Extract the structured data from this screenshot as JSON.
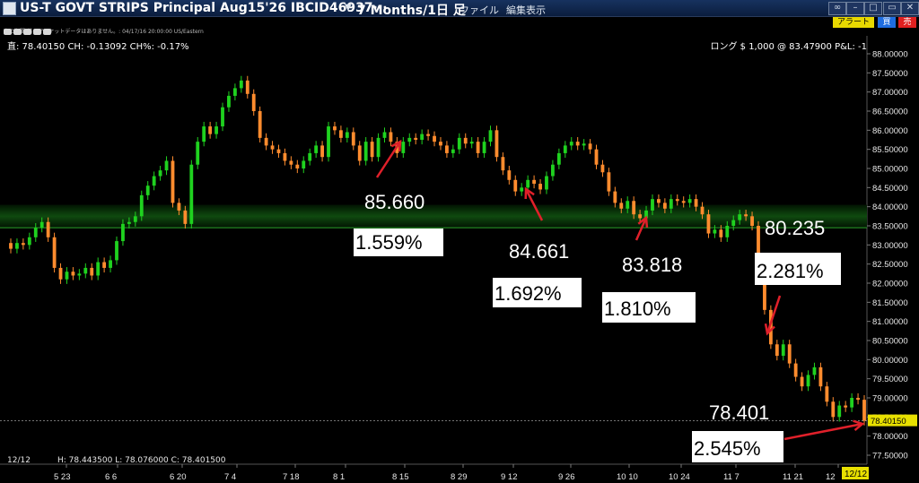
{
  "titlebar": {
    "title": "US-T GOVT STRIPS Principal Aug15'26 IBCID46937···",
    "period": "7 Months/1日 足",
    "menu": [
      "ファイル",
      "編集",
      "表示"
    ],
    "dropdown_arrow": "▼"
  },
  "toolbar": {
    "alert": "アラート",
    "buy": "買",
    "sell": "売",
    "subtitle": "次の期間(前のマーケットデータはありません。: 04/17/16 20:00:00 US/Eastern"
  },
  "info": {
    "price_line": "直: 78.40150 CH: -0.13092 CH%: -0.17%",
    "position_line": "ロング $ 1,000 @ 83.47900 P&L: -1",
    "ohlc_line": "H: 78.443500 L: 78.076000 C: 78.401500",
    "cursor_date": "12/12",
    "last_price_tag": "78.40150",
    "last_date_tag": "12/12"
  },
  "colors": {
    "up": "#1fd21f",
    "down": "#ff8c2e",
    "arrow": "#e0202a",
    "band": "#0f4a0f",
    "text": "#ffffff",
    "last_tag": "#e8e000"
  },
  "chart_data": {
    "type": "candlestick",
    "ylim": [
      77.3,
      88.3
    ],
    "yticks": [
      "88.00000",
      "87.50000",
      "87.00000",
      "86.50000",
      "86.00000",
      "85.50000",
      "85.00000",
      "84.50000",
      "84.00000",
      "83.50000",
      "83.00000",
      "82.50000",
      "82.00000",
      "81.50000",
      "81.00000",
      "80.50000",
      "80.00000",
      "79.50000",
      "79.00000",
      "78.50000",
      "78.00000",
      "77.50000"
    ],
    "ytick_values": [
      88.0,
      87.5,
      87.0,
      86.5,
      86.0,
      85.5,
      85.0,
      84.5,
      84.0,
      83.5,
      83.0,
      82.5,
      82.0,
      81.5,
      81.0,
      80.5,
      80.0,
      79.5,
      79.0,
      78.5,
      78.0,
      77.5
    ],
    "xticks": [
      "5 23",
      "6 6",
      "6 20",
      "7 4",
      "7 18",
      "8 1",
      "8 15",
      "8 29",
      "9 12",
      "9 26",
      "10 10",
      "10 24",
      "11 7",
      "11 21",
      "12"
    ],
    "closes": [
      82.9,
      83.05,
      83.0,
      83.2,
      83.45,
      83.6,
      83.2,
      82.4,
      82.1,
      82.3,
      82.2,
      82.25,
      82.4,
      82.2,
      82.55,
      82.4,
      82.6,
      83.1,
      83.55,
      83.6,
      83.75,
      84.3,
      84.55,
      84.8,
      84.95,
      85.2,
      84.1,
      83.9,
      83.55,
      85.1,
      85.7,
      86.1,
      85.9,
      86.1,
      86.6,
      86.9,
      87.1,
      87.3,
      86.95,
      86.5,
      85.8,
      85.6,
      85.5,
      85.4,
      85.2,
      85.1,
      85.0,
      85.2,
      85.4,
      85.6,
      85.3,
      86.1,
      86.0,
      85.8,
      85.95,
      85.6,
      85.2,
      85.7,
      85.3,
      85.8,
      85.95,
      85.7,
      85.4,
      85.7,
      85.8,
      85.75,
      85.9,
      85.85,
      85.7,
      85.6,
      85.4,
      85.5,
      85.8,
      85.65,
      85.7,
      85.4,
      85.7,
      86.0,
      85.3,
      84.95,
      84.7,
      84.4,
      84.5,
      84.7,
      84.6,
      84.45,
      84.8,
      85.1,
      85.4,
      85.6,
      85.7,
      85.6,
      85.65,
      85.5,
      85.1,
      84.9,
      84.4,
      84.1,
      83.95,
      84.15,
      83.8,
      83.7,
      83.9,
      84.2,
      84.1,
      83.95,
      84.2,
      84.15,
      84.1,
      84.2,
      84.0,
      83.8,
      83.3,
      83.4,
      83.2,
      83.5,
      83.65,
      83.8,
      83.75,
      83.5,
      82.1,
      81.3,
      80.4,
      80.1,
      80.4,
      79.9,
      79.55,
      79.3,
      79.6,
      79.8,
      79.3,
      78.9,
      78.5,
      78.8,
      78.75,
      79.0,
      78.95,
      78.4
    ],
    "support_band": [
      83.45,
      84.05
    ],
    "annotations": [
      {
        "value": "85.660",
        "pct": "1.559%"
      },
      {
        "value": "84.661",
        "pct": "1.692%"
      },
      {
        "value": "83.818",
        "pct": "1.810%"
      },
      {
        "value": "80.235",
        "pct": "2.281%"
      },
      {
        "value": "78.401",
        "pct": "2.545%"
      }
    ]
  }
}
